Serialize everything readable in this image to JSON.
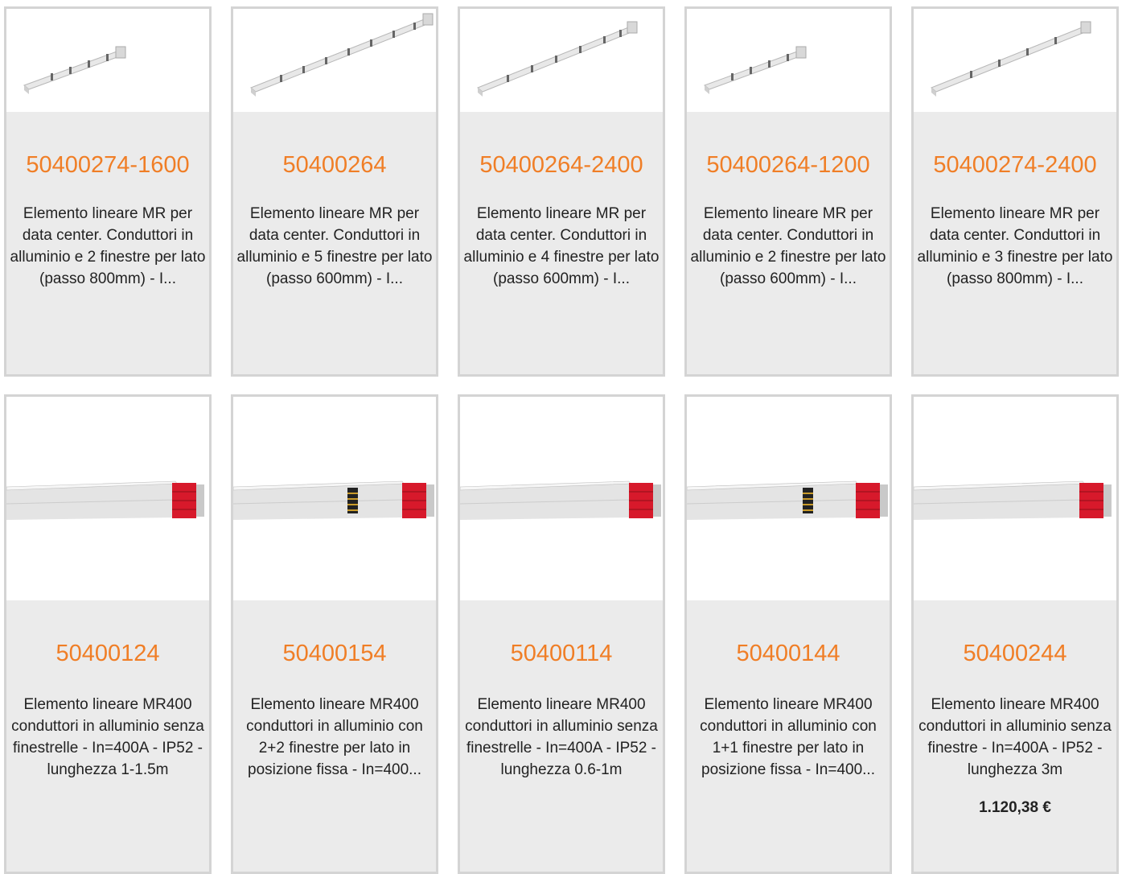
{
  "products": [
    {
      "code": "50400274-1600",
      "description": "Elemento lineare MR per data center. Conduttori in alluminio e 2 finestre per lato (passo 800mm) - I...",
      "image": "busbar-short-icon"
    },
    {
      "code": "50400264",
      "description": "Elemento lineare MR per data center. Conduttori in alluminio e 5 finestre per lato (passo 600mm) - I...",
      "image": "busbar-long-icon"
    },
    {
      "code": "50400264-2400",
      "description": "Elemento lineare MR per data center. Conduttori in alluminio e 4 finestre per lato (passo 600mm) - I...",
      "image": "busbar-medium-icon"
    },
    {
      "code": "50400264-1200",
      "description": "Elemento lineare MR per data center. Conduttori in alluminio e 2 finestre per lato (passo 600mm) - I...",
      "image": "busbar-short-icon"
    },
    {
      "code": "50400274-2400",
      "description": "Elemento lineare MR per data center. Conduttori in alluminio e 3 finestre per lato (passo 800mm) - I...",
      "image": "busbar-medium-icon"
    },
    {
      "code": "50400124",
      "description": "Elemento lineare MR400 conduttori in alluminio senza finestrelle - In=400A - IP52 - lunghezza 1-1.5m",
      "image": "busbar-red-icon"
    },
    {
      "code": "50400154",
      "description": "Elemento lineare MR400 conduttori in alluminio con 2+2 finestre per lato in posizione fissa - In=400...",
      "image": "busbar-red-window-icon"
    },
    {
      "code": "50400114",
      "description": "Elemento lineare MR400 conduttori in alluminio senza finestrelle - In=400A - IP52 - lunghezza 0.6-1m",
      "image": "busbar-red-icon"
    },
    {
      "code": "50400144",
      "description": "Elemento lineare MR400 conduttori in alluminio con 1+1 finestre per lato in posizione fissa - In=400...",
      "image": "busbar-red-window-icon"
    },
    {
      "code": "50400244",
      "description": "Elemento lineare MR400 conduttori in alluminio senza finestre - In=400A - IP52 - lunghezza 3m",
      "price": "1.120,38 €",
      "image": "busbar-red-icon"
    }
  ],
  "colors": {
    "code": "#f07e26",
    "card_bg": "#ebebeb",
    "border": "#d4d4d4",
    "busbar_red": "#d7192b"
  }
}
